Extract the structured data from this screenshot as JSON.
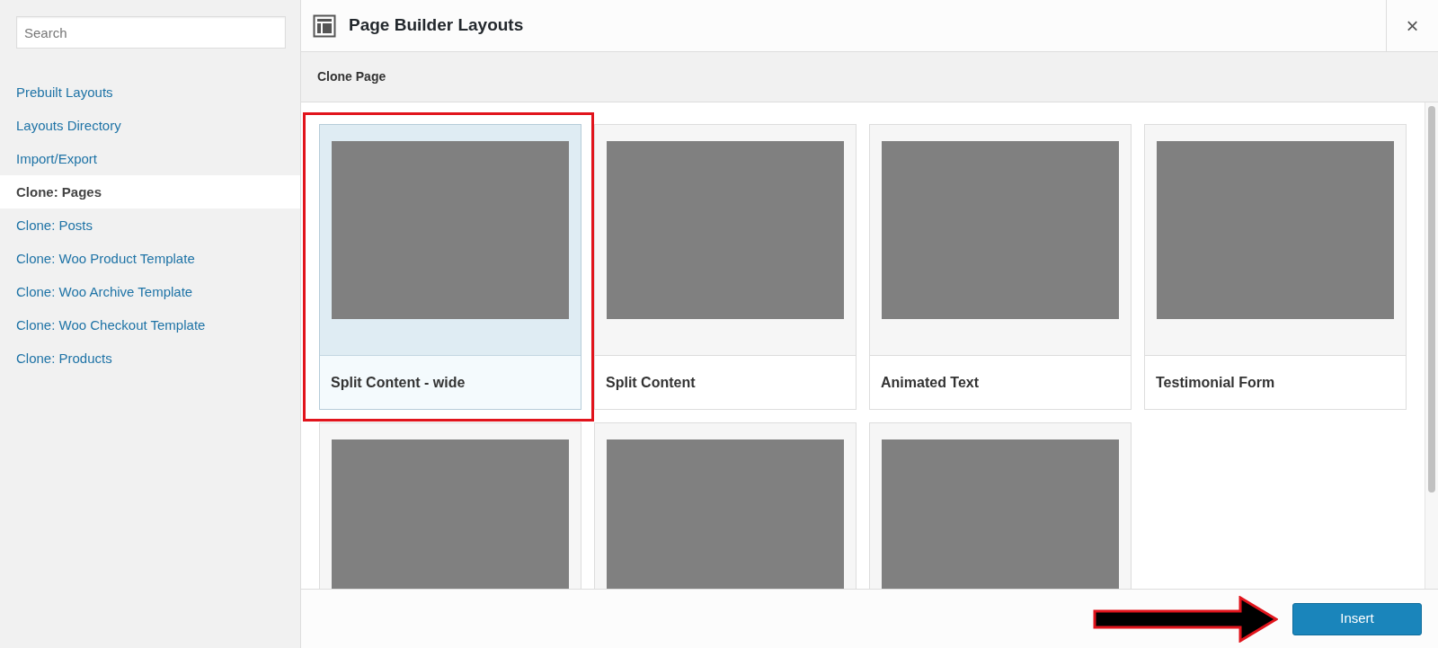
{
  "sidebar": {
    "search": {
      "placeholder": "Search"
    },
    "items": [
      {
        "label": "Prebuilt Layouts",
        "selected": false
      },
      {
        "label": "Layouts Directory",
        "selected": false
      },
      {
        "label": "Import/Export",
        "selected": false
      },
      {
        "label": "Clone: Pages",
        "selected": true
      },
      {
        "label": "Clone: Posts",
        "selected": false
      },
      {
        "label": "Clone: Woo Product Template",
        "selected": false
      },
      {
        "label": "Clone: Woo Archive Template",
        "selected": false
      },
      {
        "label": "Clone: Woo Checkout Template",
        "selected": false
      },
      {
        "label": "Clone: Products",
        "selected": false
      }
    ]
  },
  "header": {
    "title": "Page Builder Layouts",
    "close": "×"
  },
  "section": {
    "title": "Clone Page"
  },
  "layouts": [
    {
      "title": "Split Content - wide",
      "selected": true
    },
    {
      "title": "Split Content",
      "selected": false
    },
    {
      "title": "Animated Text",
      "selected": false
    },
    {
      "title": "Testimonial Form",
      "selected": false
    },
    {
      "selected": false
    },
    {
      "selected": false
    },
    {
      "selected": false
    }
  ],
  "footer": {
    "button": "Insert"
  }
}
